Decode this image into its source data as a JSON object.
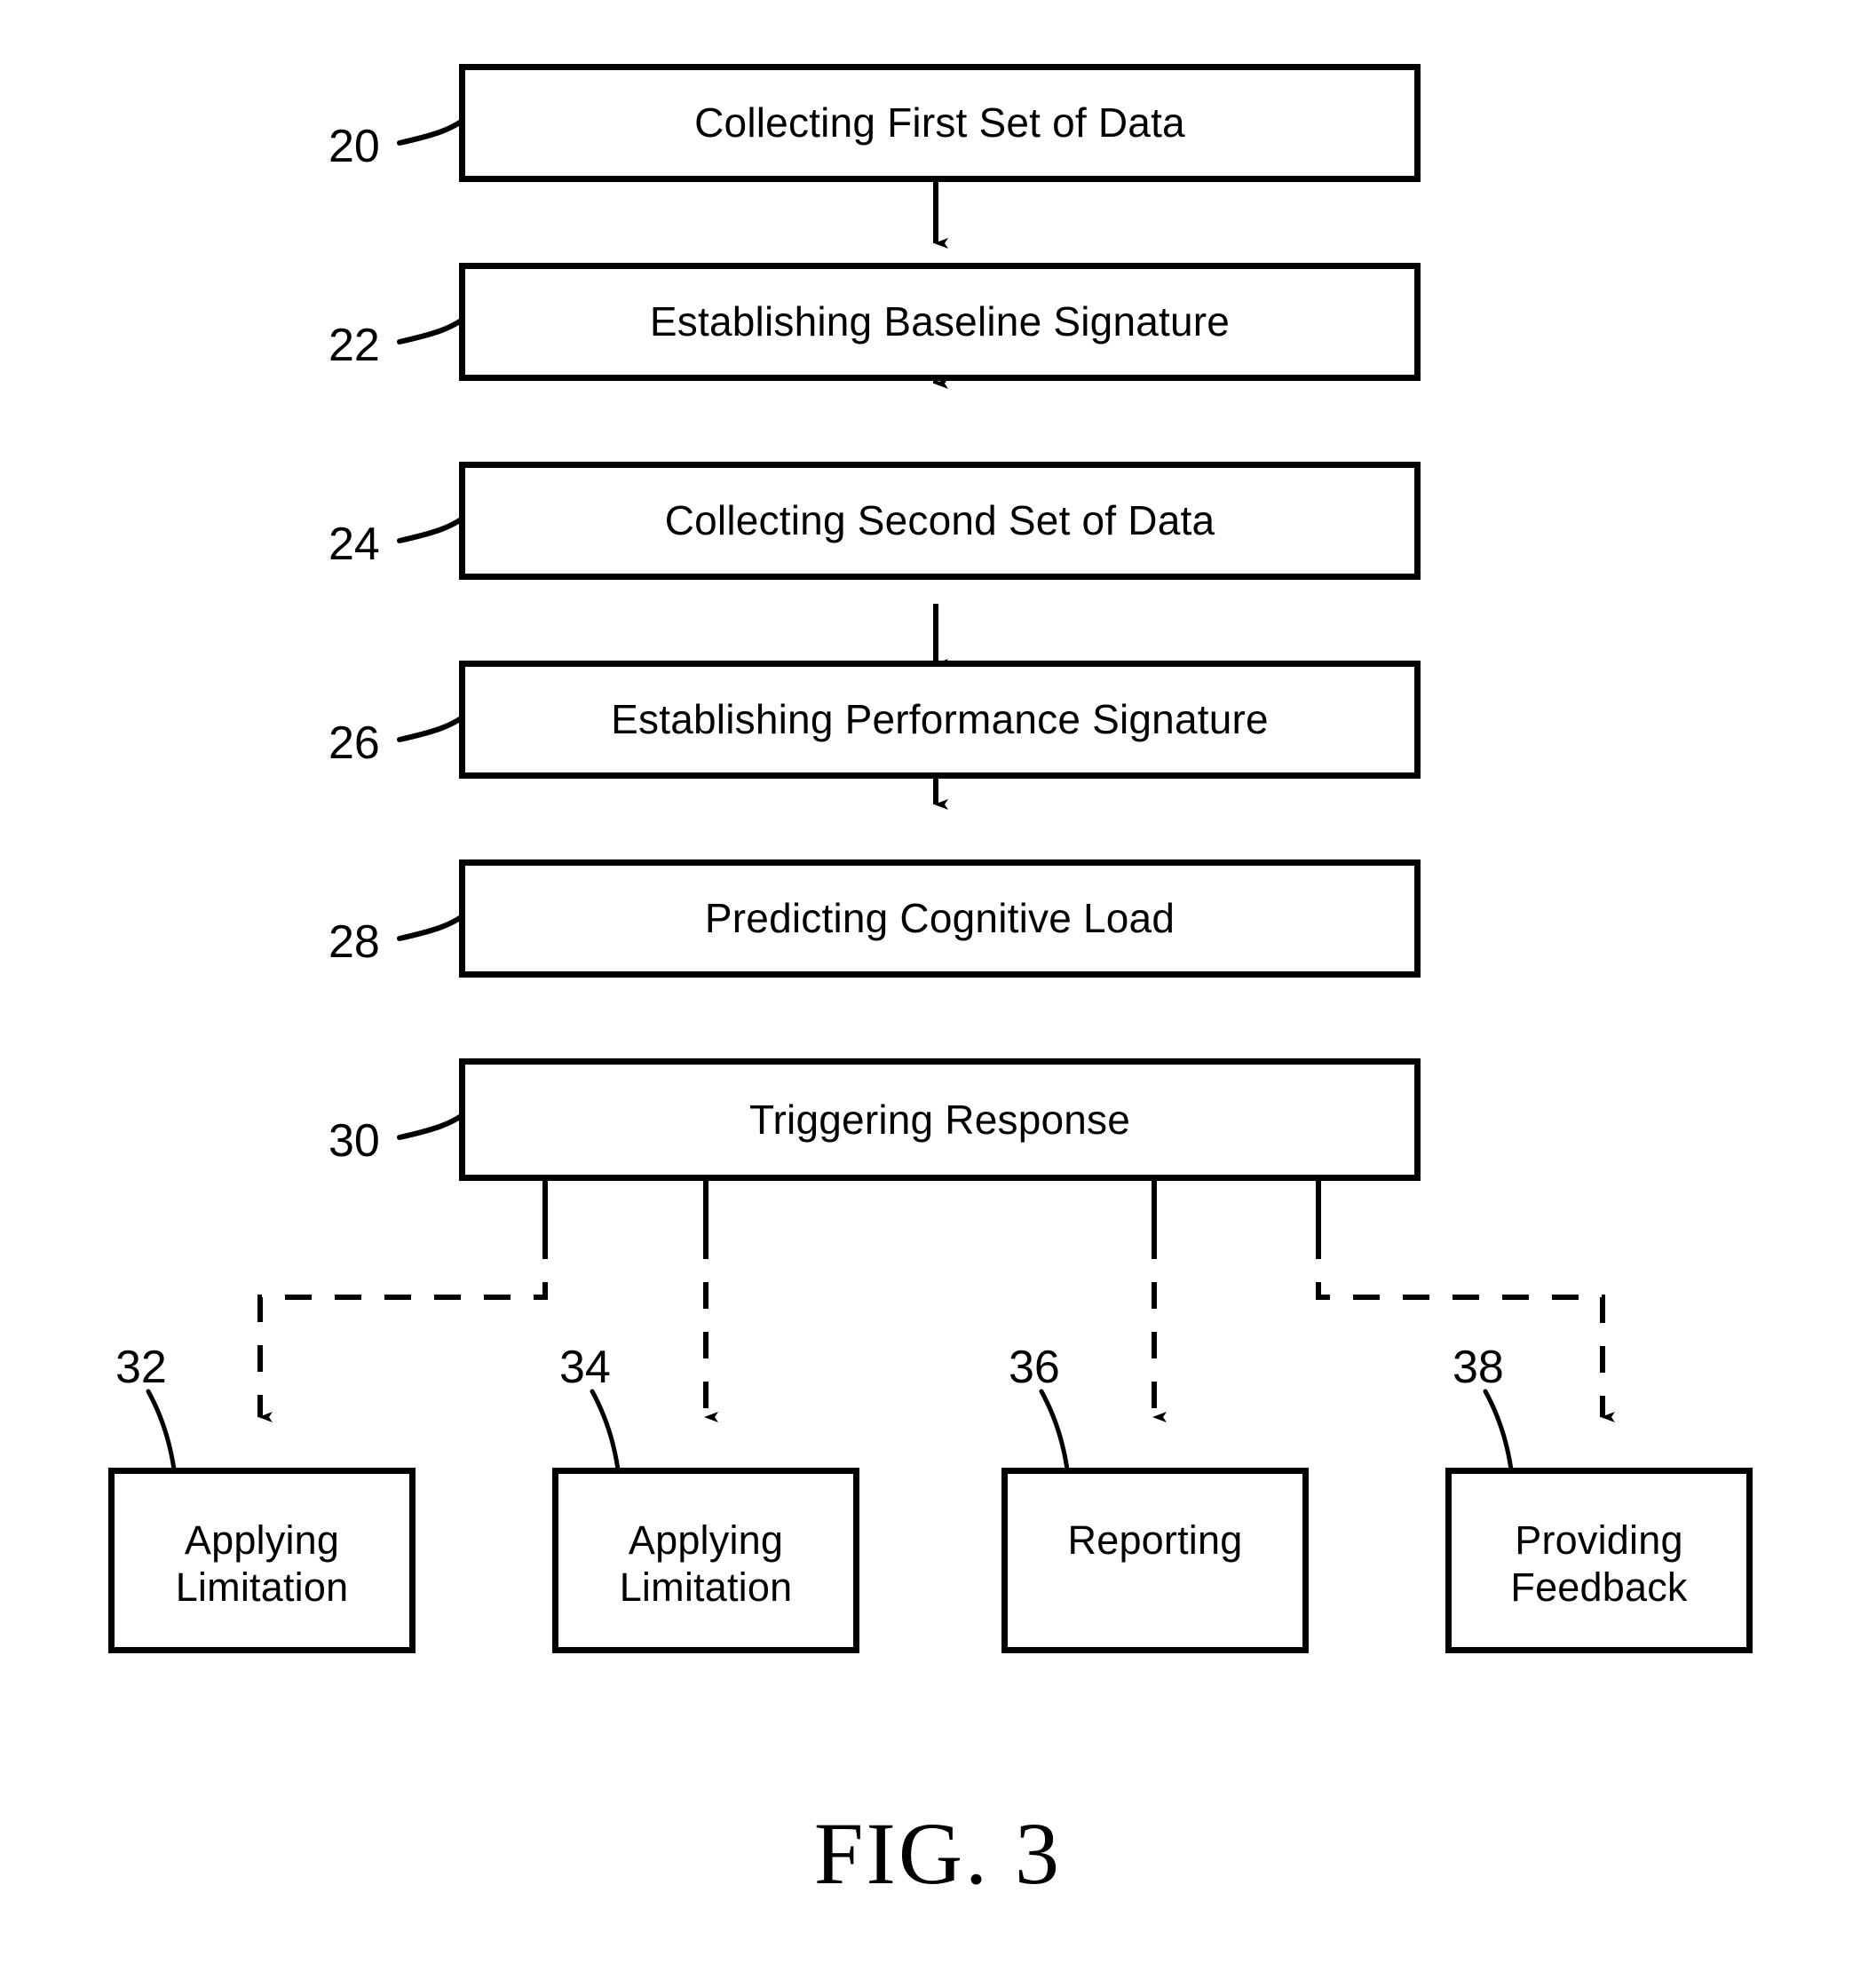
{
  "figure": {
    "caption": "FIG. 3",
    "type": "patent-flowchart"
  },
  "chart_data": {
    "type": "flowchart",
    "title": "FIG. 3",
    "orientation": "top-to-bottom",
    "nodes": [
      {
        "ref": "20",
        "label": "Collecting First Set of Data",
        "shape": "rectangle",
        "level": "main"
      },
      {
        "ref": "22",
        "label": "Establishing Baseline Signature",
        "shape": "rectangle",
        "level": "main"
      },
      {
        "ref": "24",
        "label": "Collecting Second Set of Data",
        "shape": "rectangle",
        "level": "main"
      },
      {
        "ref": "26",
        "label": "Establishing Performance Signature",
        "shape": "rectangle",
        "level": "main"
      },
      {
        "ref": "28",
        "label": "Predicting Cognitive Load",
        "shape": "rectangle",
        "level": "main"
      },
      {
        "ref": "30",
        "label": "Triggering Response",
        "shape": "rectangle",
        "level": "main"
      },
      {
        "ref": "32",
        "label": "Applying\nLimitation",
        "shape": "rectangle",
        "level": "leaf"
      },
      {
        "ref": "34",
        "label": "Applying\nLimitation",
        "shape": "rectangle",
        "level": "leaf"
      },
      {
        "ref": "36",
        "label": "Reporting",
        "shape": "rectangle",
        "level": "leaf"
      },
      {
        "ref": "38",
        "label": "Providing\nFeedback",
        "shape": "rectangle",
        "level": "leaf"
      }
    ],
    "edges": [
      {
        "from": "20",
        "to": "22",
        "style": "solid",
        "arrow": true
      },
      {
        "from": "22",
        "to": "24",
        "style": "solid",
        "arrow": true
      },
      {
        "from": "24",
        "to": "26",
        "style": "solid",
        "arrow": true
      },
      {
        "from": "26",
        "to": "28",
        "style": "solid",
        "arrow": true
      },
      {
        "from": "28",
        "to": "30",
        "style": "solid",
        "arrow": true
      },
      {
        "from": "30",
        "to": "32",
        "style": "dashed",
        "arrow": true
      },
      {
        "from": "30",
        "to": "34",
        "style": "dashed",
        "arrow": true
      },
      {
        "from": "30",
        "to": "36",
        "style": "dashed",
        "arrow": true
      },
      {
        "from": "30",
        "to": "38",
        "style": "dashed",
        "arrow": true
      }
    ]
  },
  "nodes": {
    "n20": {
      "ref": "20",
      "label": "Collecting First Set of Data"
    },
    "n22": {
      "ref": "22",
      "label": "Establishing Baseline Signature"
    },
    "n24": {
      "ref": "24",
      "label": "Collecting Second Set of Data"
    },
    "n26": {
      "ref": "26",
      "label": "Establishing Performance Signature"
    },
    "n28": {
      "ref": "28",
      "label": "Predicting Cognitive Load"
    },
    "n30": {
      "ref": "30",
      "label": "Triggering Response"
    },
    "n32": {
      "ref": "32",
      "line1": "Applying",
      "line2": "Limitation"
    },
    "n34": {
      "ref": "34",
      "line1": "Applying",
      "line2": "Limitation"
    },
    "n36": {
      "ref": "36",
      "line1": "Reporting",
      "line2": ""
    },
    "n38": {
      "ref": "38",
      "line1": "Providing",
      "line2": "Feedback"
    }
  },
  "colors": {
    "ink": "#000000",
    "paper": "#ffffff"
  }
}
